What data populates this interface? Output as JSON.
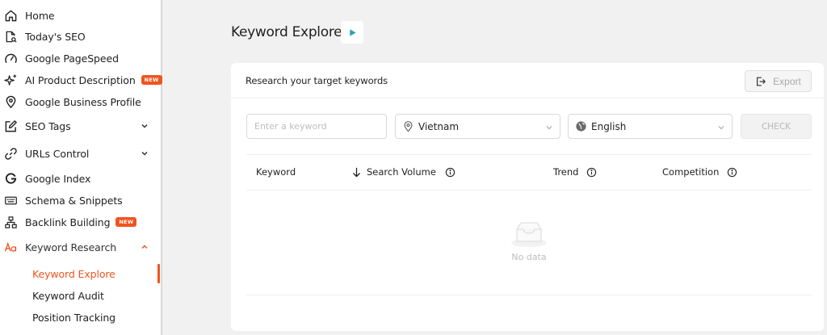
{
  "sidebar": {
    "items": [
      {
        "label": "Home",
        "icon": "home-icon"
      },
      {
        "label": "Today's SEO",
        "icon": "document-search-icon"
      },
      {
        "label": "Google PageSpeed",
        "icon": "gauge-icon"
      },
      {
        "label": "AI Product Description",
        "icon": "sparkle-icon",
        "badge": "NEW"
      },
      {
        "label": "Google Business Profile",
        "icon": "map-pin-icon"
      },
      {
        "label": "SEO Tags",
        "icon": "edit-tag-icon"
      },
      {
        "label": "URLs Control",
        "icon": "link-icon"
      },
      {
        "label": "Google Index",
        "icon": "google-icon"
      },
      {
        "label": "Schema & Snippets",
        "icon": "keyboard-icon"
      },
      {
        "label": "Backlink Building",
        "icon": "sitemap-icon",
        "badge": "NEW"
      },
      {
        "label": "Keyword Research",
        "icon": "font-aa-icon"
      }
    ],
    "subitems": [
      {
        "label": "Keyword Explore",
        "active": true
      },
      {
        "label": "Keyword Audit"
      },
      {
        "label": "Position Tracking"
      }
    ]
  },
  "main": {
    "title": "Keyword Explore",
    "card_title": "Research your target keywords",
    "export_label": "Export",
    "keyword_placeholder": "Enter a keyword",
    "location_value": "Vietnam",
    "language_value": "English",
    "check_label": "CHECK",
    "columns": [
      "Keyword",
      "Search Volume",
      "Trend",
      "Competition"
    ],
    "empty_text": "No data"
  },
  "colors": {
    "accent": "#f0541e",
    "play": "#2a9fbe",
    "background": "#f1f1f1"
  }
}
